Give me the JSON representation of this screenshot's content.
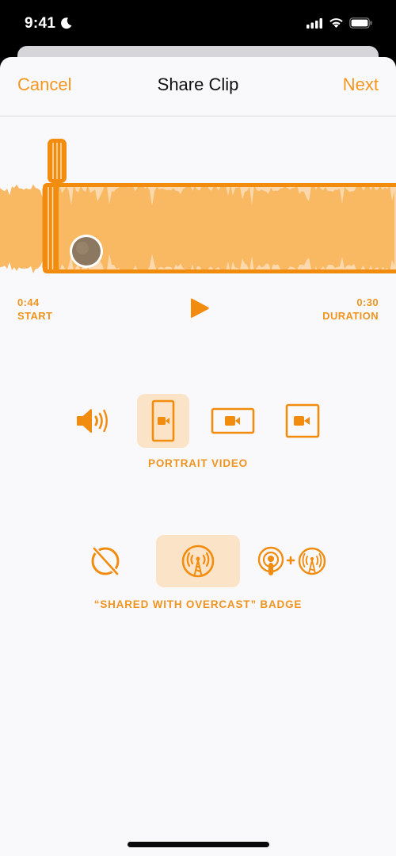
{
  "status_bar": {
    "time": "9:41",
    "icons": [
      "moon-icon",
      "cellular-signal-icon",
      "wifi-icon",
      "battery-icon"
    ]
  },
  "nav": {
    "cancel_label": "Cancel",
    "title": "Share Clip",
    "next_label": "Next"
  },
  "clip": {
    "start_time": "0:44",
    "start_label": "START",
    "duration_time": "0:30",
    "duration_label": "DURATION",
    "play_icon": "play-icon"
  },
  "formats": {
    "options": [
      {
        "name": "audio-only",
        "icon": "speaker-icon"
      },
      {
        "name": "portrait-video",
        "icon": "portrait-video-icon"
      },
      {
        "name": "landscape-video",
        "icon": "landscape-video-icon"
      },
      {
        "name": "square-video",
        "icon": "square-video-icon"
      }
    ],
    "selected_index": 1,
    "selected_label": "PORTRAIT VIDEO"
  },
  "badges": {
    "options": [
      {
        "name": "no-badge",
        "icon": "no-badge-icon"
      },
      {
        "name": "overcast-badge",
        "icon": "overcast-icon"
      },
      {
        "name": "podcasts-plus-overcast-badge",
        "icon": "podcasts-plus-overcast-icon"
      }
    ],
    "selected_index": 1,
    "selected_label": "“SHARED WITH OVERCAST” BADGE"
  },
  "colors": {
    "accent": "#f5961f",
    "accent_dark": "#f28c0f",
    "waveform": "#f9b862",
    "waveform_light": "#fbd9ad",
    "selected_bg": "#fae3c7",
    "sheet_bg": "#f9f8fb"
  }
}
